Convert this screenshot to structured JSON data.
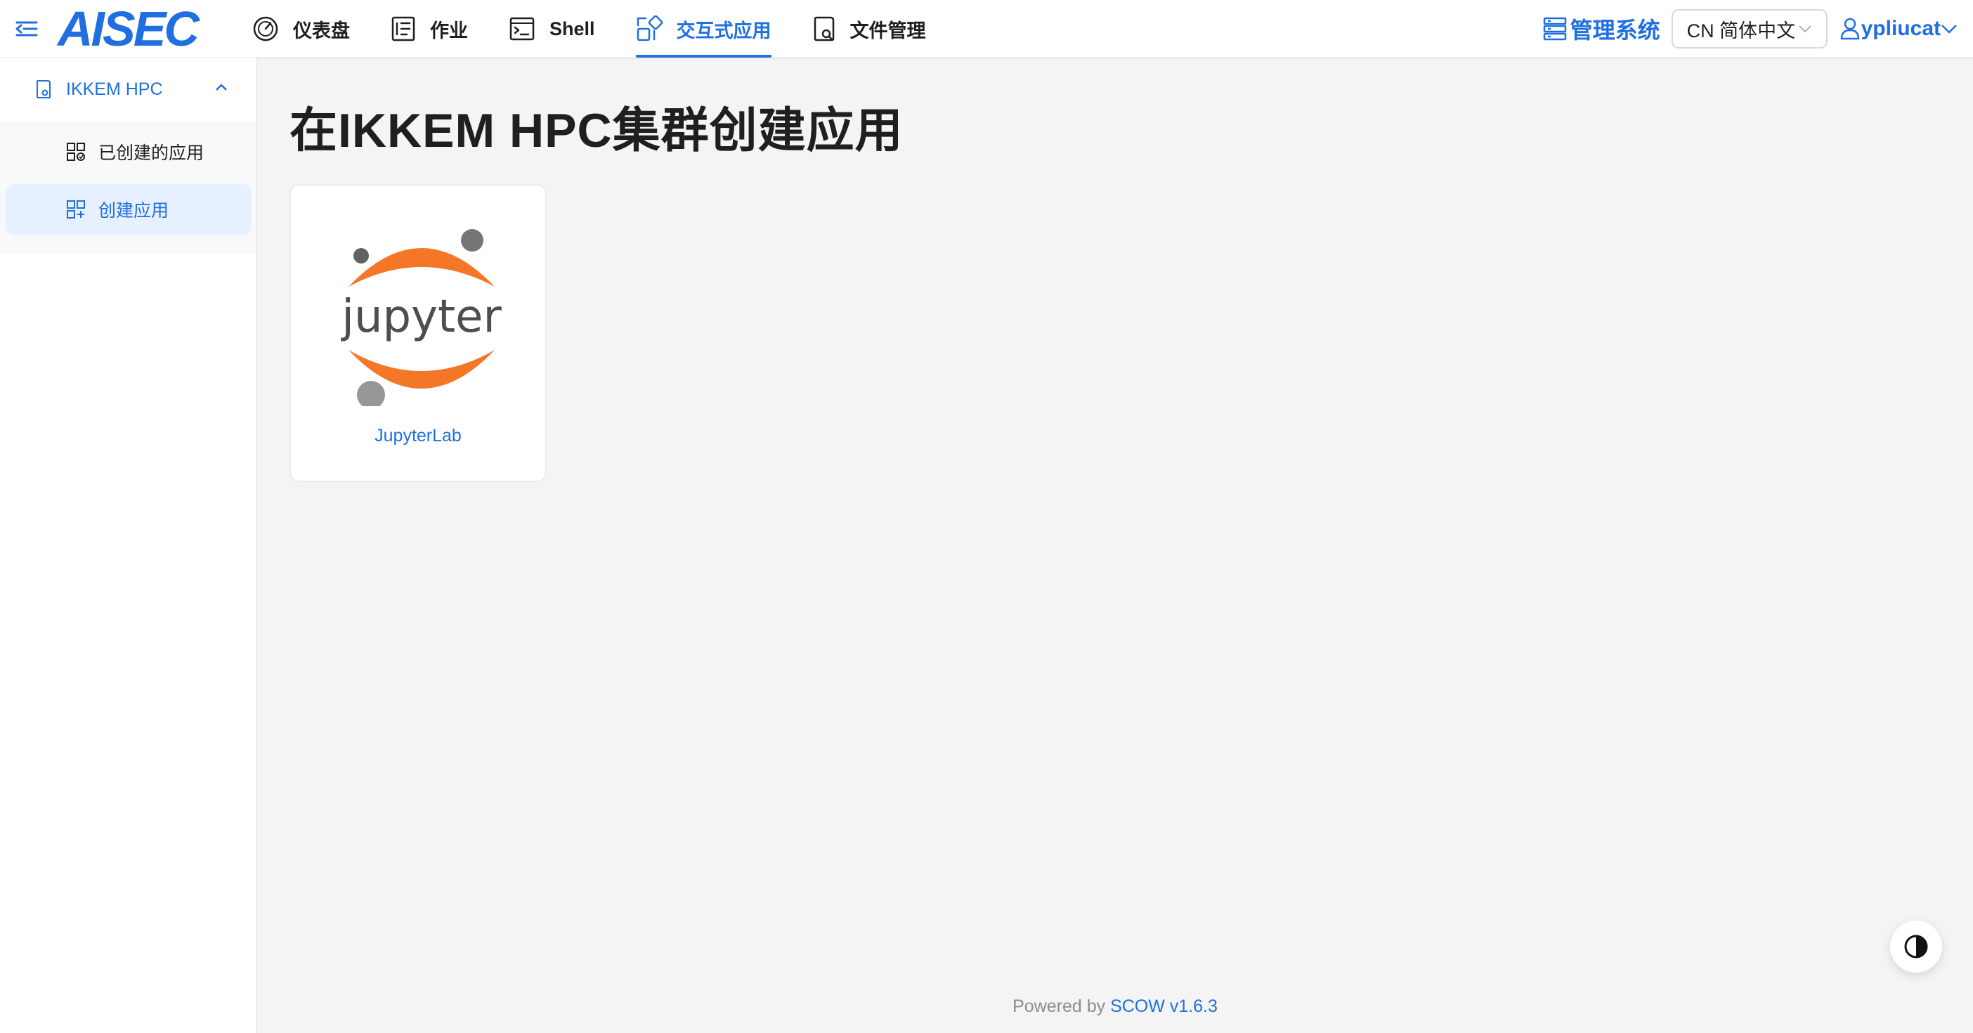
{
  "header": {
    "menu_toggle_icon": "menu-fold-icon",
    "logo_text": "AISEC",
    "nav": [
      {
        "label": "仪表盘",
        "icon": "dashboard-icon"
      },
      {
        "label": "作业",
        "icon": "job-icon"
      },
      {
        "label": "Shell",
        "icon": "terminal-icon"
      },
      {
        "label": "交互式应用",
        "icon": "interactive-app-icon",
        "active": true
      },
      {
        "label": "文件管理",
        "icon": "file-icon"
      }
    ],
    "admin_label": "管理系统",
    "language": "CN 简体中文",
    "user": "ypliucat"
  },
  "sidebar": {
    "group_label": "IKKEM HPC",
    "items": [
      {
        "label": "已创建的应用",
        "icon": "apps-created-icon"
      },
      {
        "label": "创建应用",
        "icon": "app-add-icon",
        "active": true
      }
    ]
  },
  "main": {
    "title": "在IKKEM HPC集群创建应用",
    "apps": [
      {
        "name": "JupyterLab",
        "logo_text": "jupyter"
      }
    ]
  },
  "footer": {
    "prefix": "Powered by ",
    "link": "SCOW v1.6.3"
  },
  "colors": {
    "accent": "#1f6fe0",
    "jupyter_orange": "#f37726",
    "background": "#f4f4f4"
  }
}
